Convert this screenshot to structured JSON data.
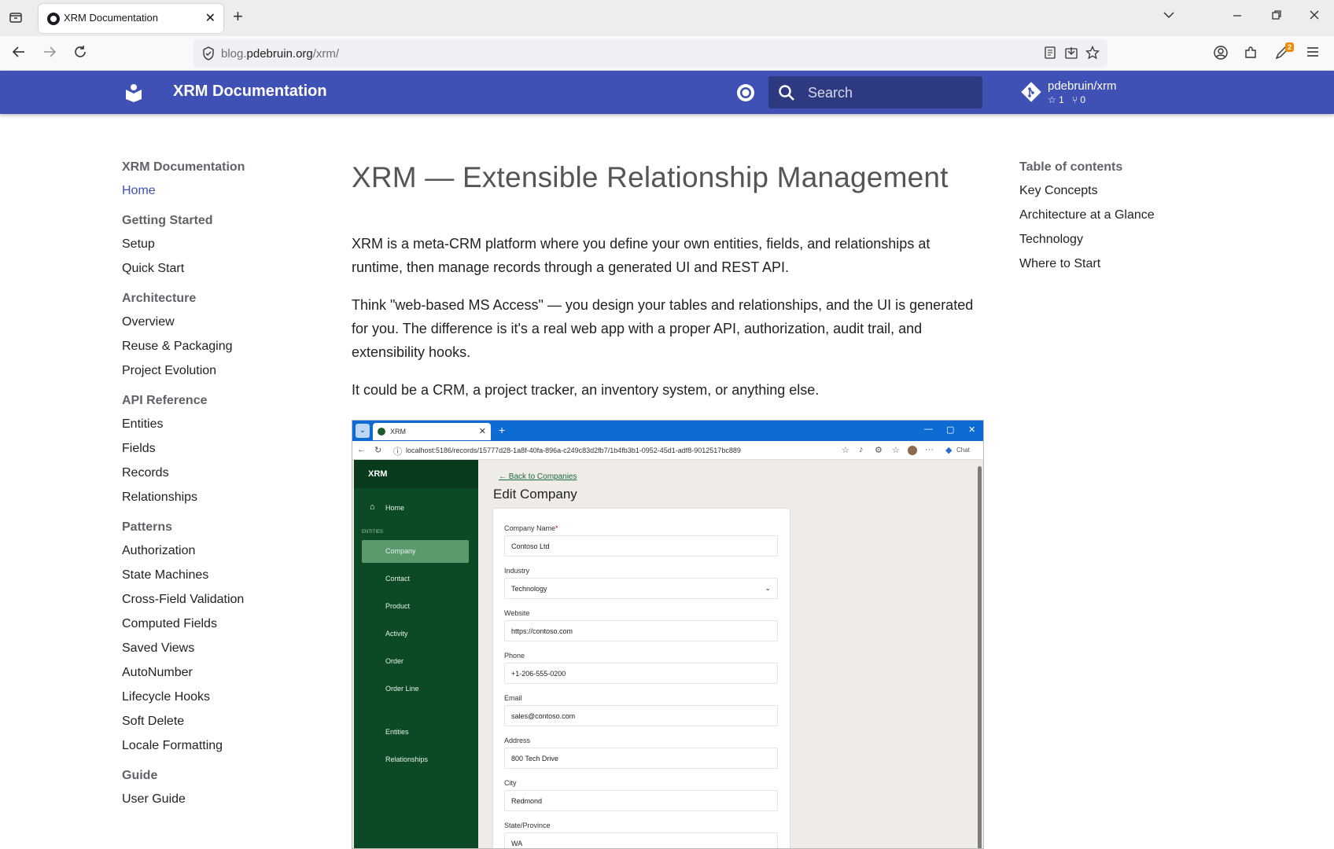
{
  "browser": {
    "tab_title": "XRM Documentation",
    "url_host_prefix": "blog.",
    "url_host": "pdebruin.org",
    "url_path": "/xrm/",
    "badge_count": "2"
  },
  "header": {
    "site_title": "XRM Documentation",
    "search_placeholder": "Search",
    "repo_name": "pdebruin/xrm",
    "repo_stars": "1",
    "repo_forks": "0"
  },
  "nav": {
    "title": "XRM Documentation",
    "home": "Home",
    "sections": [
      {
        "title": "Getting Started",
        "items": [
          "Setup",
          "Quick Start"
        ]
      },
      {
        "title": "Architecture",
        "items": [
          "Overview",
          "Reuse & Packaging",
          "Project Evolution"
        ]
      },
      {
        "title": "API Reference",
        "items": [
          "Entities",
          "Fields",
          "Records",
          "Relationships"
        ]
      },
      {
        "title": "Patterns",
        "items": [
          "Authorization",
          "State Machines",
          "Cross-Field Validation",
          "Computed Fields",
          "Saved Views",
          "AutoNumber",
          "Lifecycle Hooks",
          "Soft Delete",
          "Locale Formatting"
        ]
      },
      {
        "title": "Guide",
        "items": [
          "User Guide"
        ]
      }
    ]
  },
  "main": {
    "title": "XRM — Extensible Relationship Management",
    "p1": "XRM is a meta-CRM platform where you define your own entities, fields, and relationships at runtime, then manage records through a generated UI and REST API.",
    "p2": "Think \"web-based MS Access\" — you design your tables and relationships, and the UI is generated for you. The difference is it's a real web app with a proper API, authorization, audit trail, and extensibility hooks.",
    "p3": "It could be a CRM, a project tracker, an inventory system, or anything else."
  },
  "toc": {
    "title": "Table of contents",
    "items": [
      "Key Concepts",
      "Architecture at a Glance",
      "Technology",
      "Where to Start"
    ]
  },
  "screenshot": {
    "tab_title": "XRM",
    "url": "localhost:5186/records/15777d28-1a8f-40fa-896a-c249c83d2fb7/1b4fb3b1-0952-45d1-adf8-9012517bc889",
    "chat_label": "Chat",
    "brand": "XRM",
    "home": "Home",
    "entities_label": "ENTITIES",
    "entity_items": [
      "Company",
      "Contact",
      "Product",
      "Activity",
      "Order",
      "Order Line"
    ],
    "admin_items": [
      "Entities",
      "Relationships"
    ],
    "back_link": "← Back to Companies",
    "heading": "Edit Company",
    "fields": [
      {
        "label": "Company Name",
        "required": "*",
        "value": "Contoso Ltd"
      },
      {
        "label": "Industry",
        "value": "Technology"
      },
      {
        "label": "Website",
        "value": "https://contoso.com"
      },
      {
        "label": "Phone",
        "value": "+1-206-555-0200"
      },
      {
        "label": "Email",
        "value": "sales@contoso.com"
      },
      {
        "label": "Address",
        "value": "800 Tech Drive"
      },
      {
        "label": "City",
        "value": "Redmond"
      },
      {
        "label": "State/Province",
        "value": "WA"
      }
    ]
  },
  "colors": {
    "primary": "#3f51b5",
    "inner_sidebar": "#0b4a24",
    "inner_tabbar": "#0c6cd4"
  }
}
